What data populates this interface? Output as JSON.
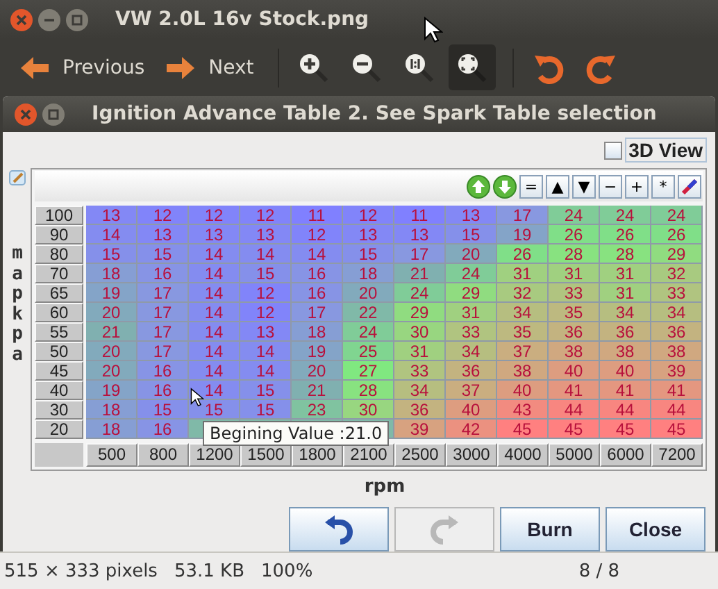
{
  "window": {
    "title": "VW 2.0L 16v Stock.png"
  },
  "toolbar": [
    {
      "kind": "back",
      "label": "Previous",
      "selected": false
    },
    {
      "kind": "forward",
      "label": "Next",
      "selected": false
    },
    {
      "kind": "zoom-in",
      "selected": false
    },
    {
      "kind": "zoom-out",
      "selected": false
    },
    {
      "kind": "normal-size",
      "selected": false
    },
    {
      "kind": "best-fit",
      "selected": true
    },
    {
      "kind": "rotate-left",
      "selected": false
    },
    {
      "kind": "rotate-right",
      "selected": false
    }
  ],
  "dialog": {
    "title": "Ignition Advance Table 2. See Spark Table selection",
    "view_3d": {
      "label": "3D View",
      "checked": false
    },
    "tools": [
      {
        "kind": "up"
      },
      {
        "kind": "down"
      },
      {
        "kind": "text",
        "label": "="
      },
      {
        "kind": "text",
        "label": "▲"
      },
      {
        "kind": "text",
        "label": "▼"
      },
      {
        "kind": "text",
        "label": "−"
      },
      {
        "kind": "text",
        "label": "+"
      },
      {
        "kind": "text",
        "label": "*"
      },
      {
        "kind": "pen"
      }
    ],
    "y_axis_label": "map kpa",
    "table": {
      "column_headers": [
        "500",
        "800",
        "1200",
        "1500",
        "1800",
        "2100",
        "2500",
        "3000",
        "4000",
        "5000",
        "6000",
        "7200"
      ],
      "rows": [
        {
          "header": "100",
          "cells": [
            "13",
            "12",
            "12",
            "12",
            "11",
            "12",
            "11",
            "13",
            "17",
            "24",
            "24",
            "24"
          ]
        },
        {
          "header": "90",
          "cells": [
            "14",
            "13",
            "13",
            "13",
            "12",
            "13",
            "13",
            "15",
            "19",
            "26",
            "26",
            "26"
          ]
        },
        {
          "header": "80",
          "cells": [
            "15",
            "15",
            "14",
            "14",
            "14",
            "15",
            "17",
            "20",
            "26",
            "28",
            "28",
            "29"
          ]
        },
        {
          "header": "70",
          "cells": [
            "18",
            "16",
            "14",
            "15",
            "16",
            "18",
            "21",
            "24",
            "31",
            "31",
            "31",
            "32"
          ]
        },
        {
          "header": "65",
          "cells": [
            "19",
            "17",
            "14",
            "12",
            "16",
            "20",
            "24",
            "29",
            "32",
            "33",
            "31",
            "33"
          ]
        },
        {
          "header": "60",
          "cells": [
            "20",
            "17",
            "14",
            "12",
            "17",
            "22",
            "29",
            "31",
            "34",
            "35",
            "34",
            "34"
          ]
        },
        {
          "header": "55",
          "cells": [
            "21",
            "17",
            "14",
            "13",
            "18",
            "24",
            "30",
            "33",
            "35",
            "36",
            "36",
            "36"
          ]
        },
        {
          "header": "50",
          "cells": [
            "20",
            "17",
            "14",
            "14",
            "19",
            "25",
            "31",
            "34",
            "37",
            "38",
            "38",
            "38"
          ]
        },
        {
          "header": "45",
          "cells": [
            "20",
            "16",
            "14",
            "14",
            "20",
            "27",
            "33",
            "36",
            "38",
            "40",
            "40",
            "39"
          ]
        },
        {
          "header": "40",
          "cells": [
            "19",
            "16",
            "14",
            "15",
            "21",
            "28",
            "34",
            "37",
            "40",
            "41",
            "41",
            "41"
          ]
        },
        {
          "header": "30",
          "cells": [
            "18",
            "15",
            "15",
            "15",
            "23",
            "30",
            "36",
            "40",
            "43",
            "44",
            "44",
            "44"
          ]
        },
        {
          "header": "20",
          "cells": [
            "18",
            "16",
            null,
            null,
            null,
            null,
            "39",
            "42",
            "45",
            "45",
            "45",
            "45"
          ]
        }
      ]
    },
    "tooltip": "Begining Value :21.0",
    "x_axis_label": "rpm",
    "buttons": [
      {
        "kind": "undo",
        "disabled": false
      },
      {
        "kind": "redo",
        "disabled": true
      },
      {
        "kind": "text",
        "label": "Burn",
        "disabled": false
      },
      {
        "kind": "text",
        "label": "Close",
        "disabled": false
      }
    ]
  },
  "status_bar": {
    "size": "515 × 333 pixels",
    "file_size": "53.1 KB",
    "zoom": "100%",
    "position": "8 / 8"
  }
}
